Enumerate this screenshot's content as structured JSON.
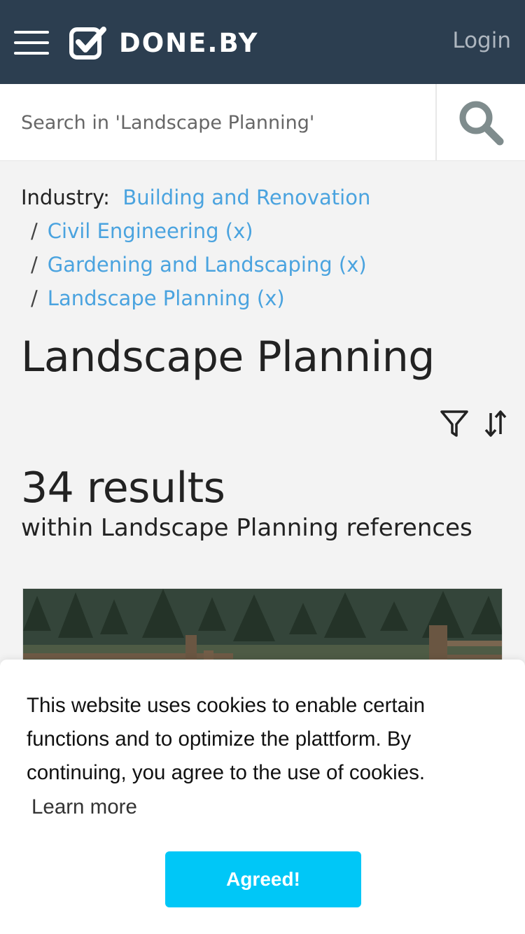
{
  "header": {
    "logo_text": "DONE.BY",
    "login_label": "Login",
    "background": "#2c3e50"
  },
  "search": {
    "placeholder": "Search in 'Landscape Planning'",
    "value": ""
  },
  "breadcrumb": {
    "label": "Industry:",
    "root": "Building and Renovation",
    "separator": "/",
    "items": [
      {
        "label": "Civil Engineering (x)"
      },
      {
        "label": "Gardening and Landscaping (x)"
      },
      {
        "label": "Landscape Planning (x)"
      }
    ],
    "link_color": "#4aa3df"
  },
  "page": {
    "title": "Landscape Planning",
    "results_count": "34 results",
    "results_sub": "within Landscape Planning references"
  },
  "icons": {
    "menu": "hamburger-menu-icon",
    "logo": "checkbox-check-icon",
    "search": "magnifier-icon",
    "filter": "funnel-icon",
    "sort": "sort-arrows-icon"
  },
  "cookie_banner": {
    "text": "This website uses cookies to enable certain functions and to optimize the plattform. By continuing, you agree to the use of cookies.",
    "learn_more": "Learn more",
    "accept_label": "Agreed!",
    "accept_color": "#00c7f7"
  }
}
